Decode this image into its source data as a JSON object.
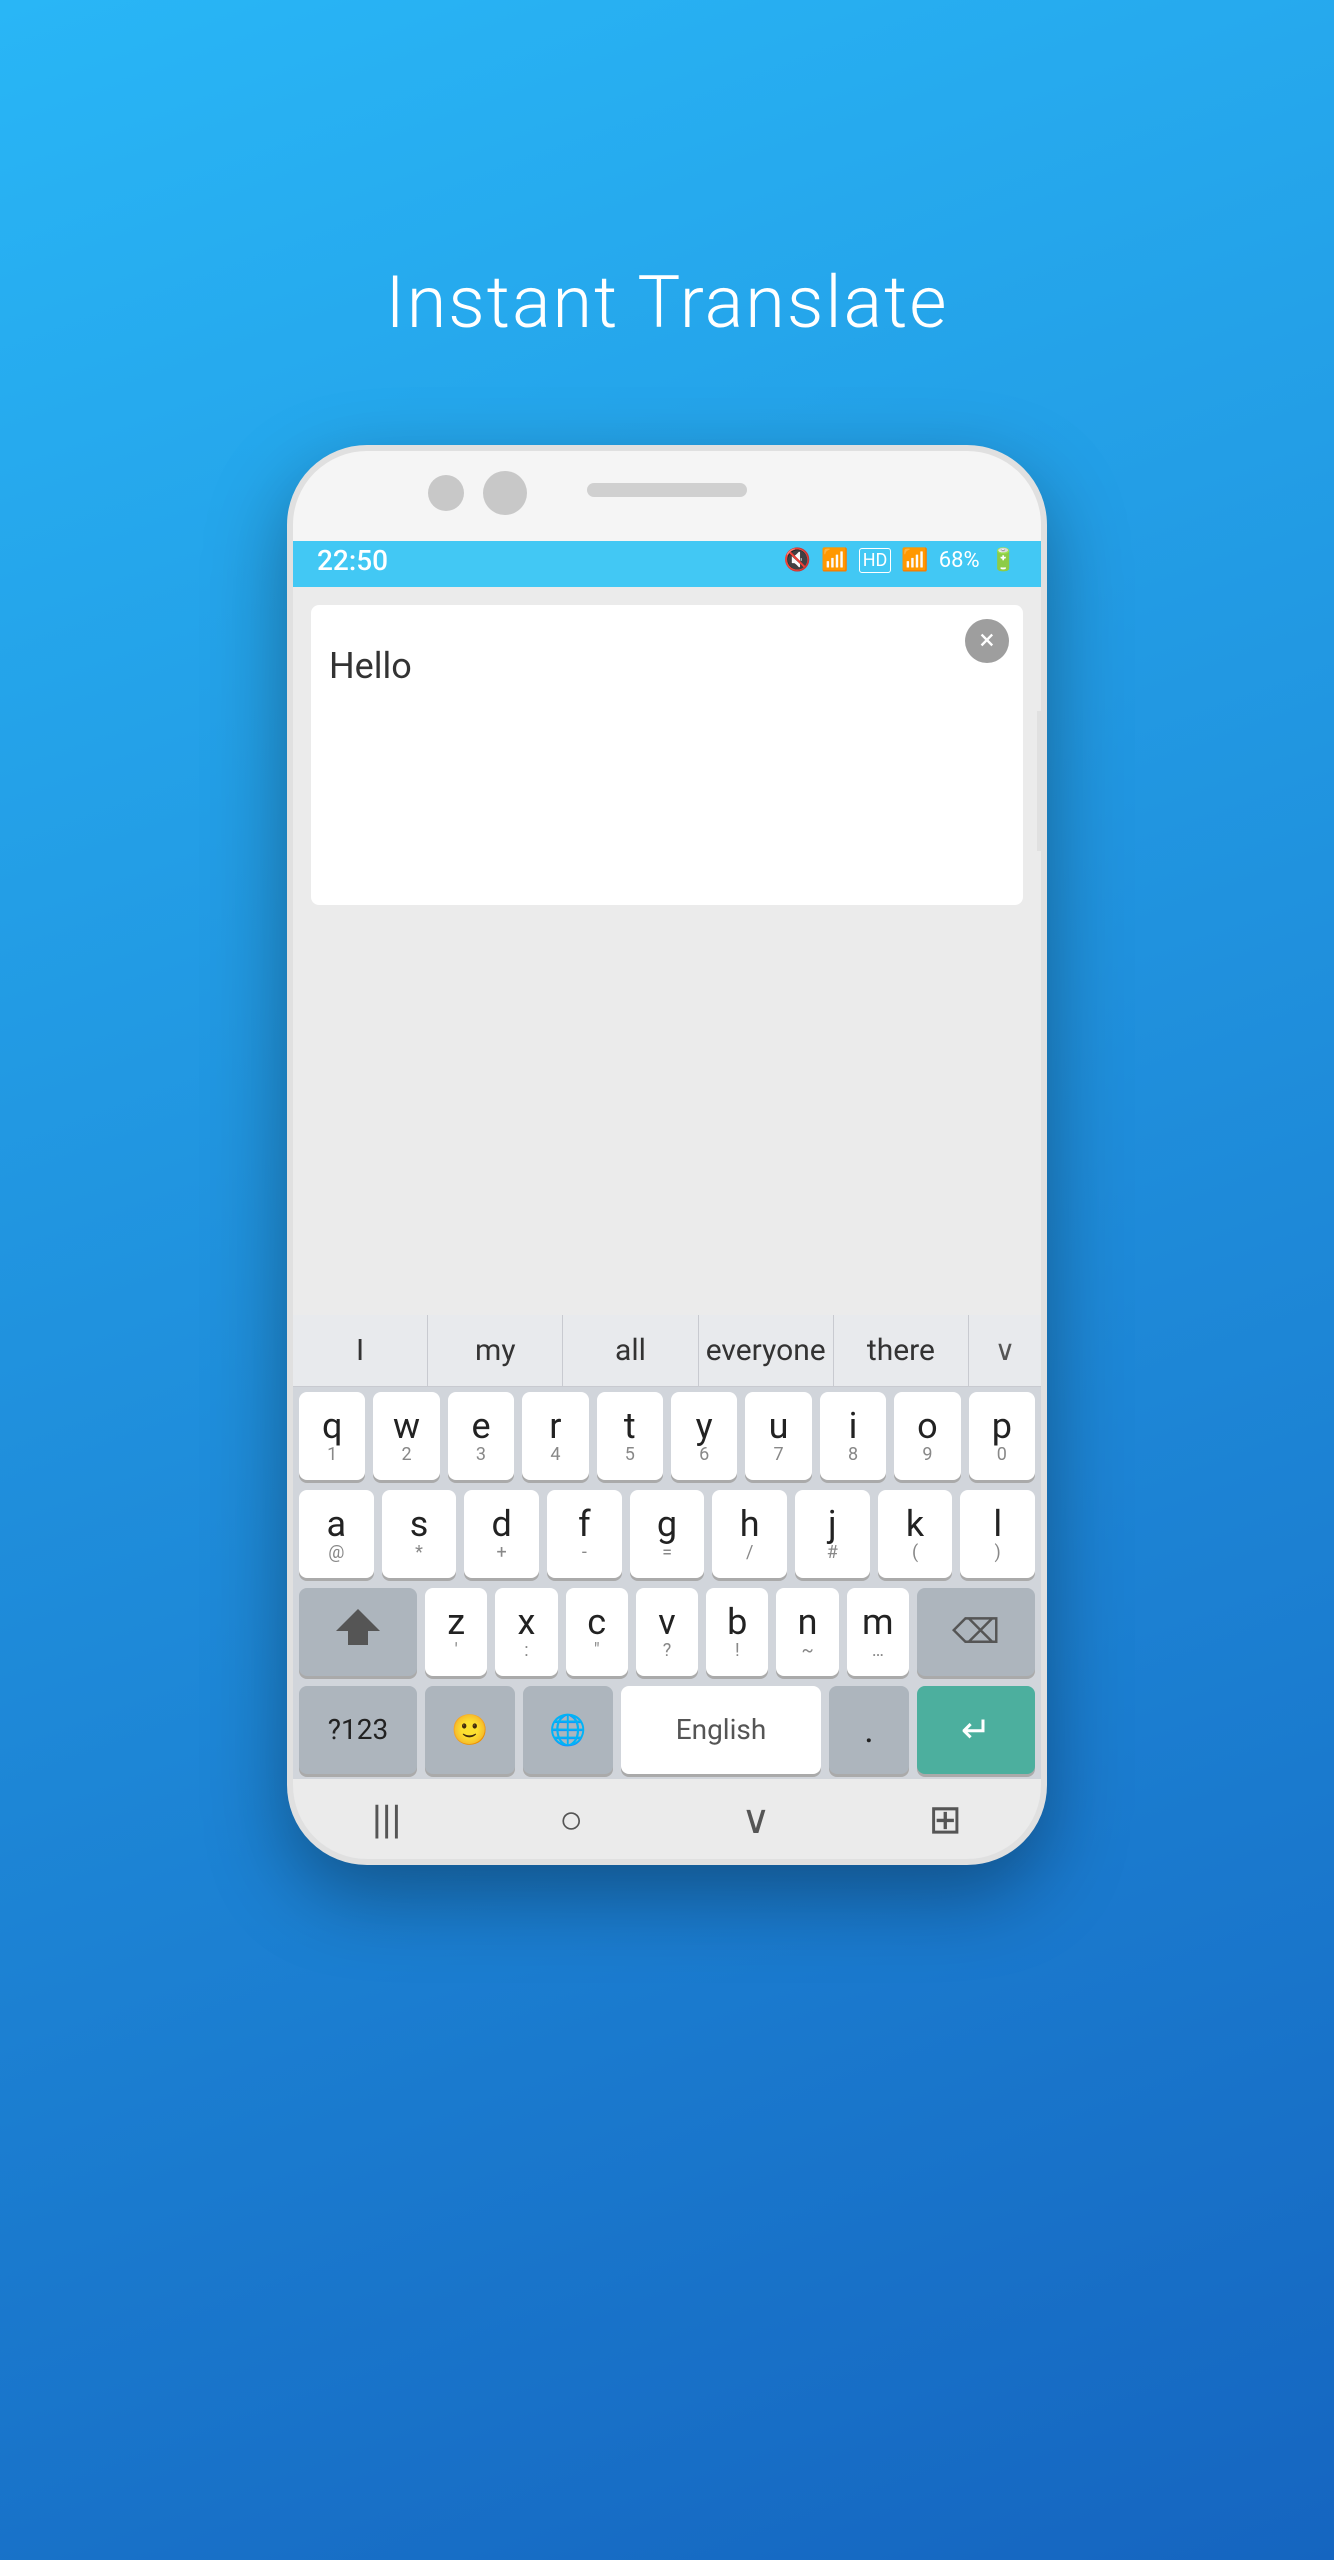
{
  "app": {
    "title": "Instant Translate"
  },
  "status_bar": {
    "time": "22:50",
    "battery": "68%",
    "icons": [
      "mute",
      "wifi",
      "HD",
      "signal"
    ]
  },
  "input": {
    "text": "Hello",
    "clear_button_label": "×"
  },
  "suggestions": {
    "items": [
      "I",
      "my",
      "all",
      "everyone",
      "there"
    ],
    "expand_icon": "∨"
  },
  "keyboard": {
    "rows": [
      [
        "q",
        "w",
        "e",
        "r",
        "t",
        "y",
        "u",
        "i",
        "o",
        "p"
      ],
      [
        "a",
        "s",
        "d",
        "f",
        "g",
        "h",
        "j",
        "k",
        "l"
      ],
      [
        "z",
        "x",
        "c",
        "v",
        "b",
        "n",
        "m"
      ]
    ],
    "row_subs": [
      [
        "1",
        "2",
        "3",
        "4",
        "5",
        "6",
        "7",
        "8",
        "9",
        "0"
      ],
      [
        "@",
        "*",
        "+",
        "-",
        "=",
        "/",
        "#",
        "(",
        ")"
      ],
      [
        "'",
        ":",
        "\"",
        "?",
        "!",
        "~",
        "…"
      ]
    ],
    "space_label": "English",
    "num_key": "?123",
    "enter_icon": "↵"
  },
  "nav_bar": {
    "items": [
      "|||",
      "○",
      "∨",
      "⊞"
    ]
  }
}
